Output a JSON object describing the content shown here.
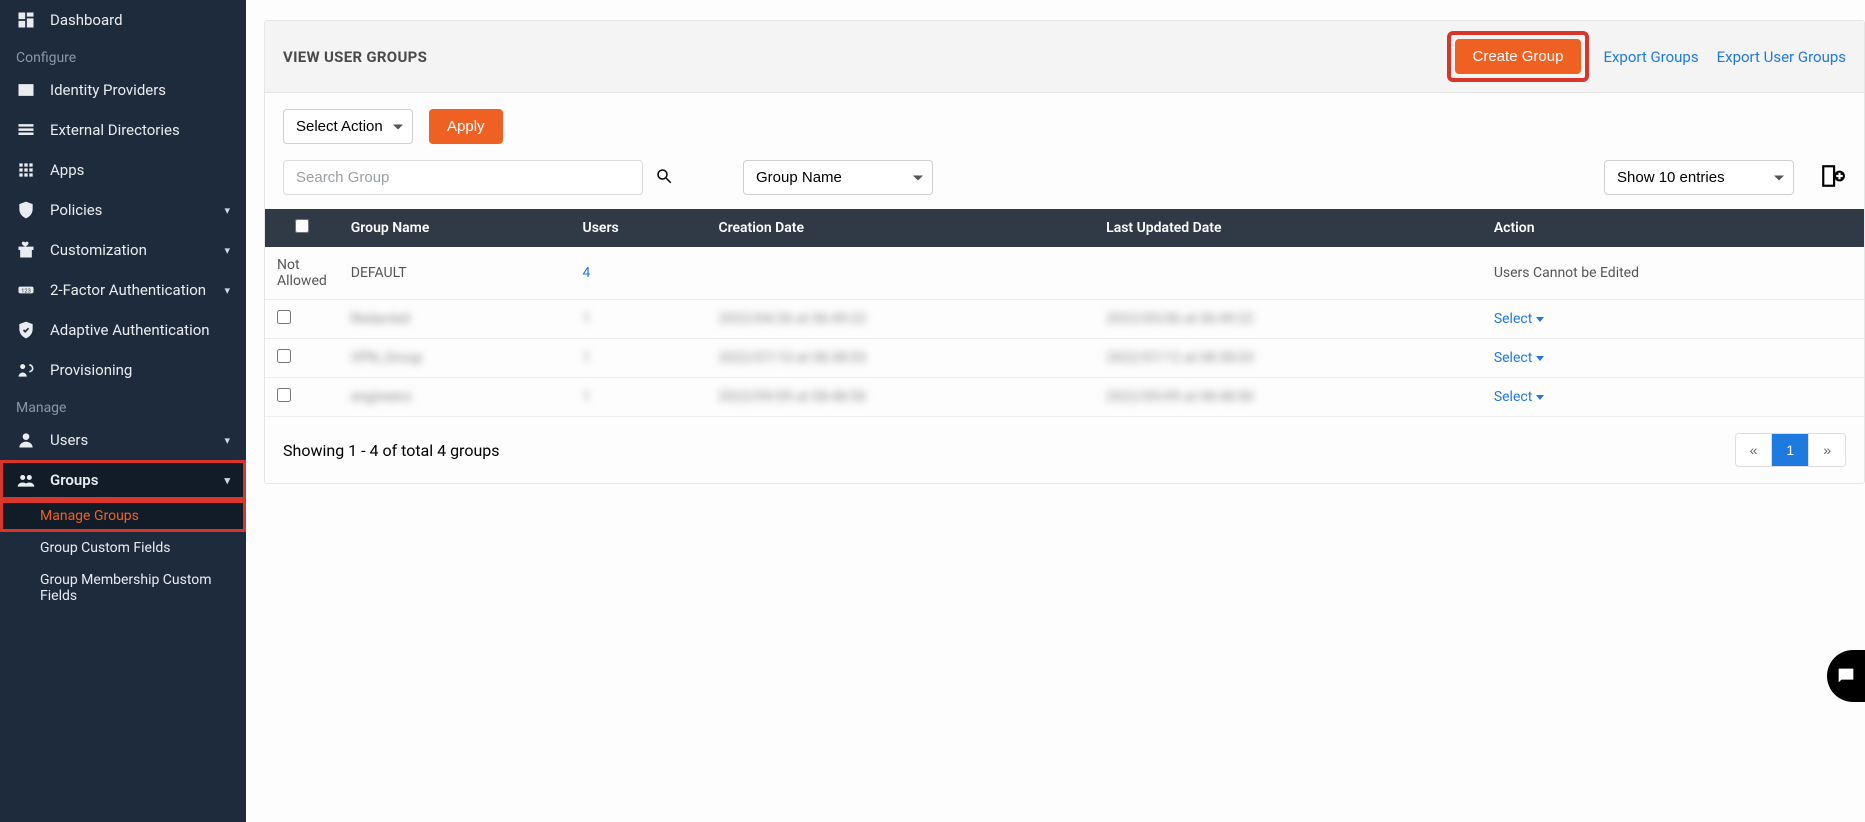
{
  "sidebar": {
    "sections": {
      "configure": "Configure",
      "manage": "Manage"
    },
    "items": {
      "dashboard": "Dashboard",
      "identity_providers": "Identity Providers",
      "external_directories": "External Directories",
      "apps": "Apps",
      "policies": "Policies",
      "customization": "Customization",
      "two_factor": "2-Factor Authentication",
      "adaptive_auth": "Adaptive Authentication",
      "provisioning": "Provisioning",
      "users": "Users",
      "groups": "Groups"
    },
    "groups_sub": {
      "manage_groups": "Manage Groups",
      "group_custom_fields": "Group Custom Fields",
      "group_membership_custom_fields": "Group Membership Custom Fields"
    }
  },
  "header": {
    "title": "VIEW USER GROUPS",
    "create_group": "Create Group",
    "export_groups": "Export Groups",
    "export_user_groups": "Export User Groups"
  },
  "toolbar": {
    "select_action": "Select Action",
    "apply": "Apply",
    "search_placeholder": "Search Group",
    "group_name_filter": "Group Name",
    "show_entries": "Show 10 entries"
  },
  "table": {
    "columns": {
      "group_name": "Group Name",
      "users": "Users",
      "creation_date": "Creation Date",
      "last_updated_date": "Last Updated Date",
      "action": "Action"
    },
    "rows": [
      {
        "checkbox_text": "Not Allowed",
        "group_name": "DEFAULT",
        "users": "4",
        "creation_date": "",
        "last_updated_date": "",
        "action_text": "Users Cannot be Edited",
        "has_checkbox": false,
        "has_select": false,
        "blurred": false
      },
      {
        "group_name": "Redacted",
        "users": "1",
        "creation_date": "2022/04/26 at 06:49:22",
        "last_updated_date": "2022/05/06 at 06:49:22",
        "action_text": "Select",
        "has_checkbox": true,
        "has_select": true,
        "blurred": true
      },
      {
        "group_name": "VPN_Group",
        "users": "1",
        "creation_date": "2022/07/10 at 08:38:03",
        "last_updated_date": "2022/07/12 at 08:38:03",
        "action_text": "Select",
        "has_checkbox": true,
        "has_select": true,
        "blurred": true
      },
      {
        "group_name": "engineers",
        "users": "1",
        "creation_date": "2022/09/09 at 08:48:50",
        "last_updated_date": "2022/09/09 at 08:48:50",
        "action_text": "Select",
        "has_checkbox": true,
        "has_select": true,
        "blurred": true
      }
    ]
  },
  "footer": {
    "showing": "Showing 1 - 4 of total 4 groups",
    "prev": "«",
    "page": "1",
    "next": "»"
  }
}
